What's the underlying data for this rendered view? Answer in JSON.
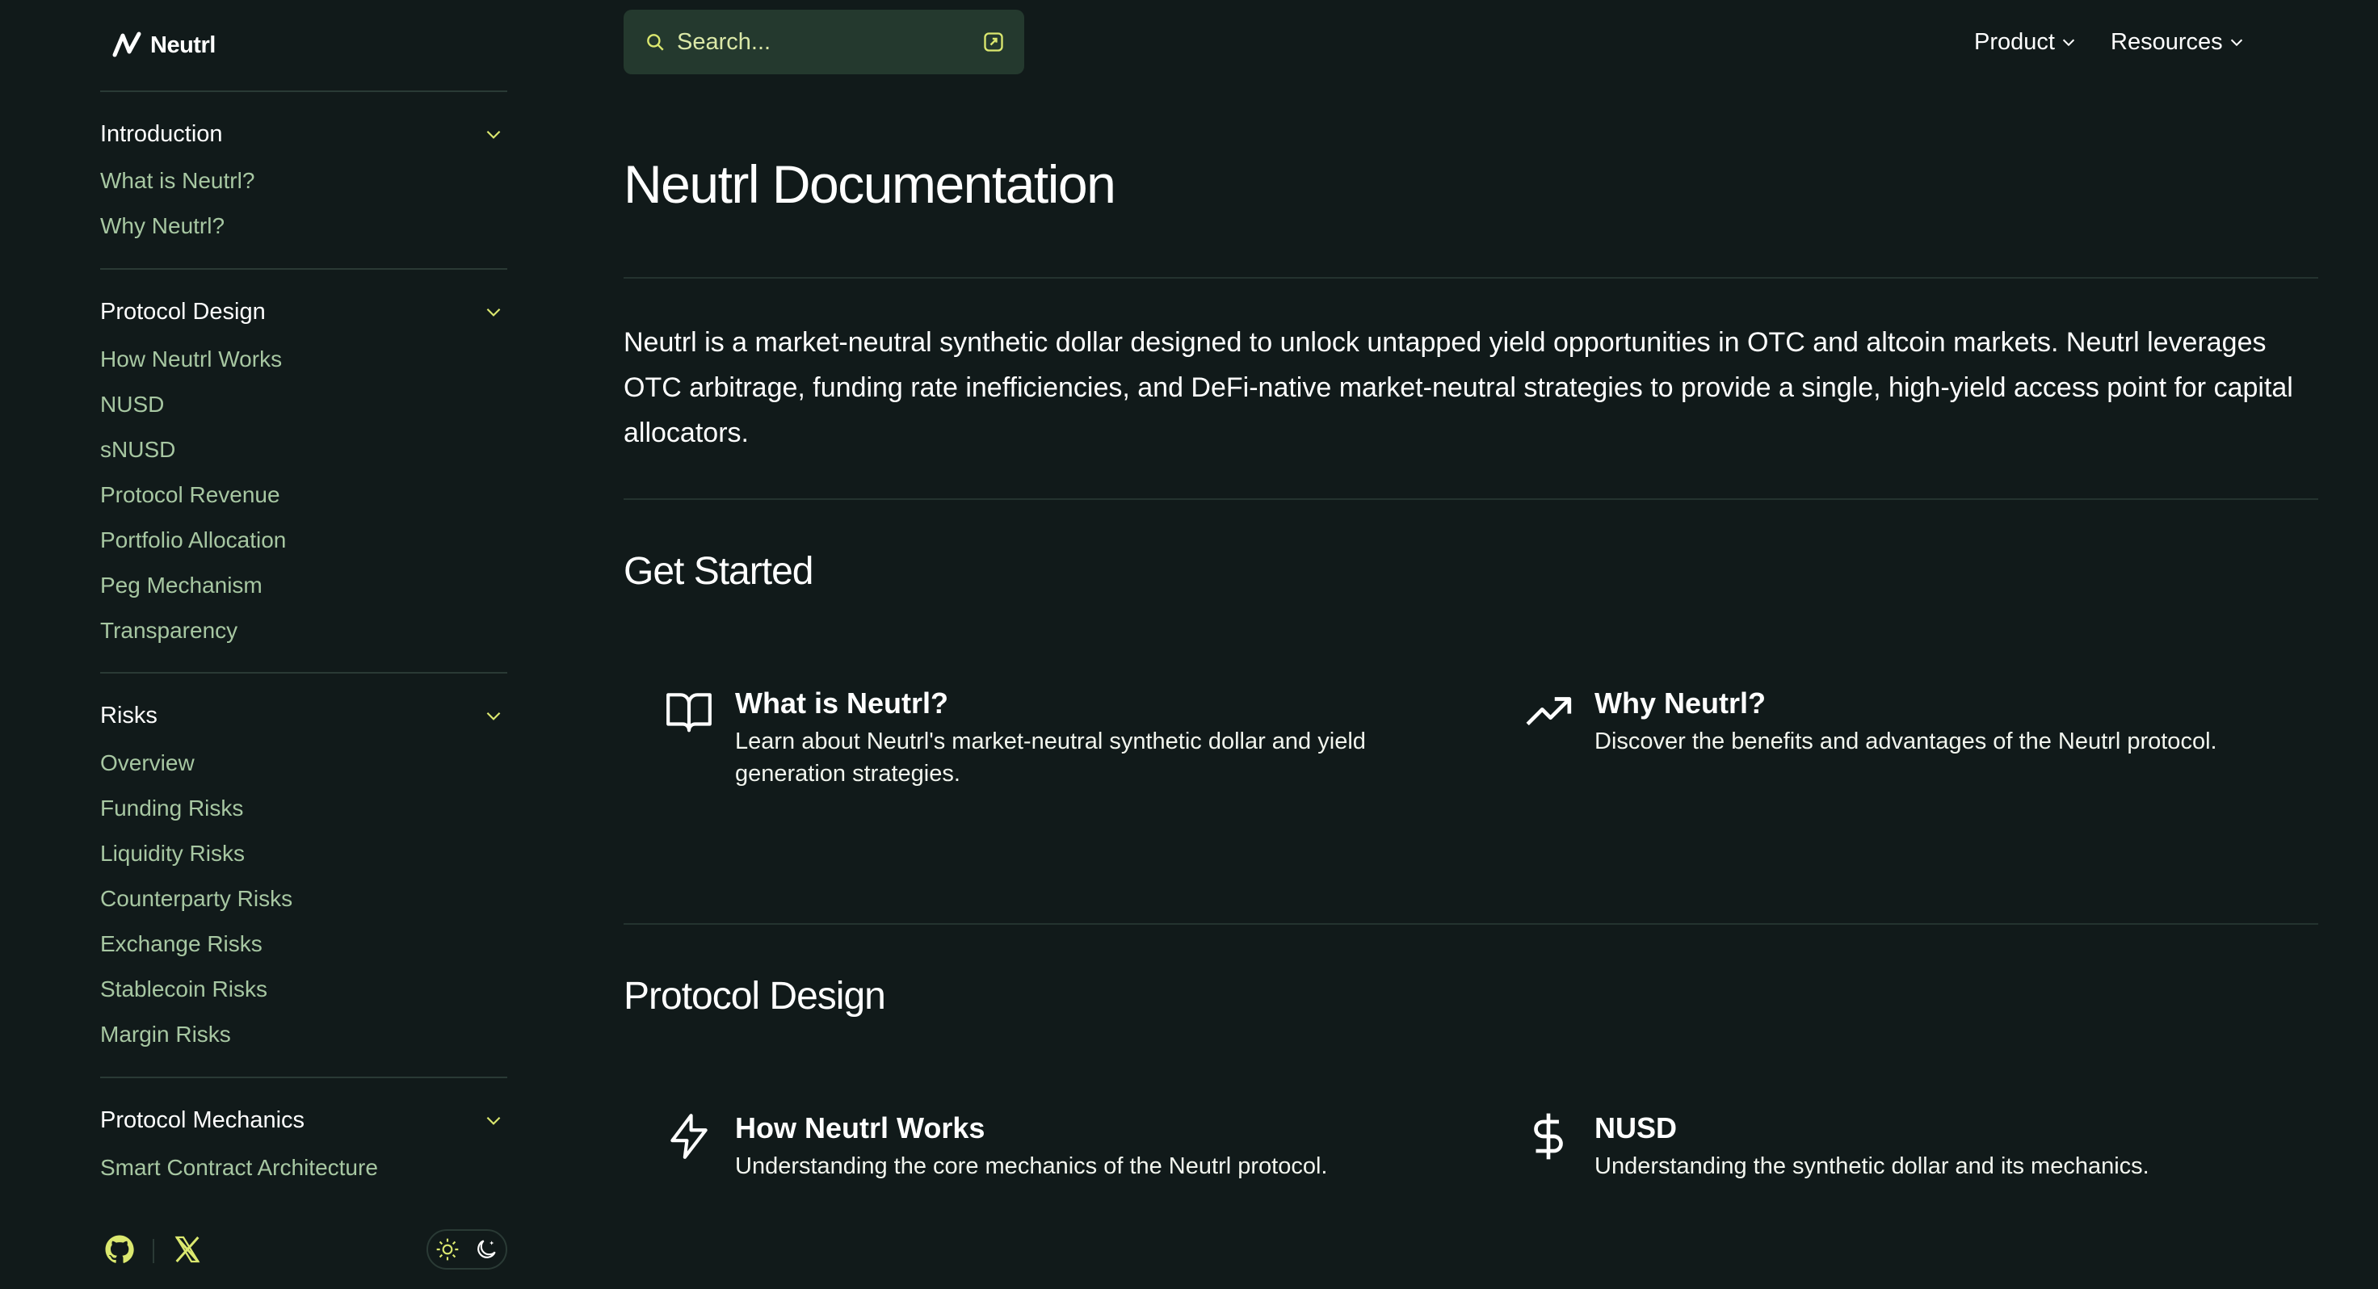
{
  "brand": {
    "name": "Neutrl"
  },
  "colors": {
    "background": "#111a1a",
    "accent": "#dbe86f",
    "link": "#a7c7a2",
    "divider": "#2a3a35",
    "search_bg": "#24392e"
  },
  "sidebar": {
    "sections": [
      {
        "title": "Introduction",
        "items": [
          "What is Neutrl?",
          "Why Neutrl?"
        ]
      },
      {
        "title": "Protocol Design",
        "items": [
          "How Neutrl Works",
          "NUSD",
          "sNUSD",
          "Protocol Revenue",
          "Portfolio Allocation",
          "Peg Mechanism",
          "Transparency"
        ]
      },
      {
        "title": "Risks",
        "items": [
          "Overview",
          "Funding Risks",
          "Liquidity Risks",
          "Counterparty Risks",
          "Exchange Risks",
          "Stablecoin Risks",
          "Margin Risks"
        ]
      },
      {
        "title": "Protocol Mechanics",
        "items": [
          "Smart Contract Architecture"
        ]
      }
    ],
    "footer": {
      "icons": [
        "github-icon",
        "x-icon",
        "sun-icon",
        "moon-icon"
      ]
    }
  },
  "search": {
    "placeholder": "Search..."
  },
  "topnav": {
    "product": "Product",
    "resources": "Resources"
  },
  "main": {
    "title": "Neutrl Documentation",
    "intro": "Neutrl is a market-neutral synthetic dollar designed to unlock untapped yield opportunities in OTC and altcoin markets. Neutrl leverages OTC arbitrage, funding rate inefficiencies, and DeFi-native market-neutral strategies to provide a single, high-yield access point for capital allocators.",
    "sections": [
      {
        "title": "Get Started",
        "cards": [
          {
            "icon": "book-open-icon",
            "title": "What is Neutrl?",
            "desc": "Learn about Neutrl's market-neutral synthetic dollar and yield generation strategies."
          },
          {
            "icon": "trending-up-icon",
            "title": "Why Neutrl?",
            "desc": "Discover the benefits and advantages of the Neutrl protocol."
          }
        ]
      },
      {
        "title": "Protocol Design",
        "cards": [
          {
            "icon": "lightning-icon",
            "title": "How Neutrl Works",
            "desc": "Understanding the core mechanics of the Neutrl protocol."
          },
          {
            "icon": "dollar-icon",
            "title": "NUSD",
            "desc": "Understanding the synthetic dollar and its mechanics."
          }
        ]
      }
    ]
  }
}
